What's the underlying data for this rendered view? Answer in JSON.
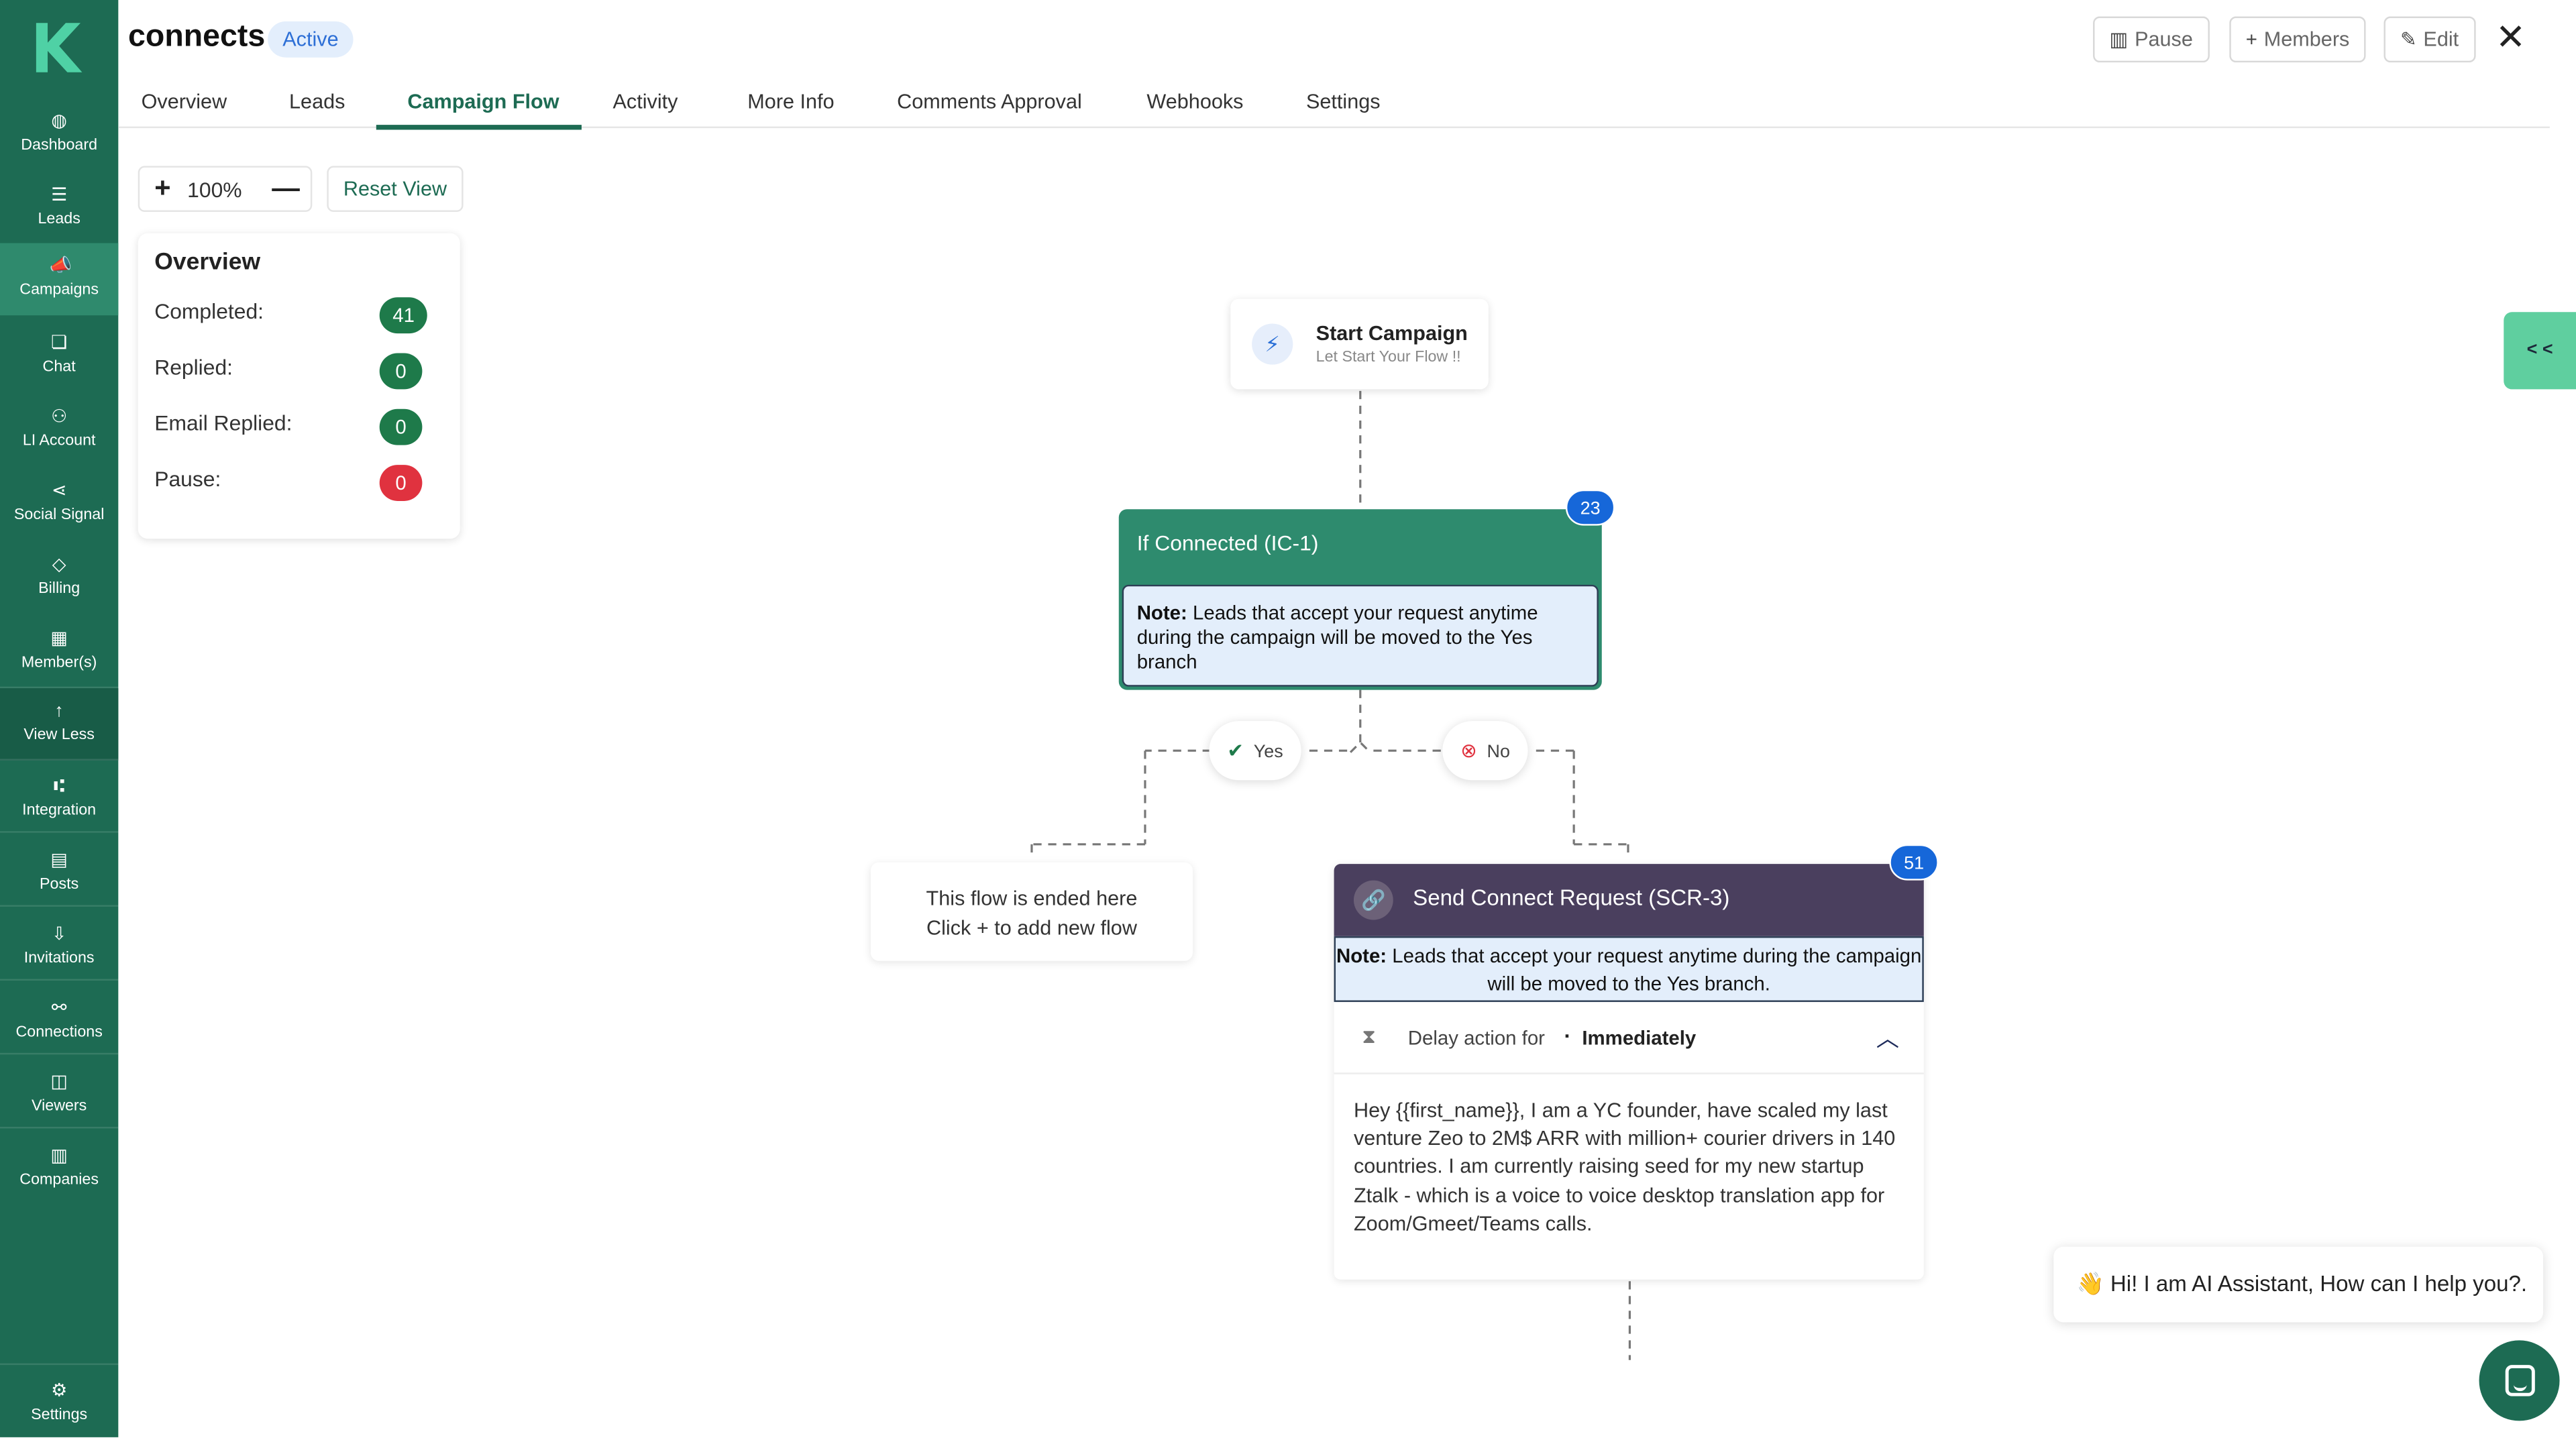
{
  "sidebar": {
    "items": [
      {
        "label": "Dashboard",
        "icon": "dashboard-icon"
      },
      {
        "label": "Leads",
        "icon": "list-icon"
      },
      {
        "label": "Campaigns",
        "icon": "megaphone-icon"
      },
      {
        "label": "Chat",
        "icon": "chat-icon"
      },
      {
        "label": "LI Account",
        "icon": "account-icon"
      },
      {
        "label": "Social Signal",
        "icon": "share-icon"
      },
      {
        "label": "Billing",
        "icon": "tag-icon"
      },
      {
        "label": "Member(s)",
        "icon": "members-icon"
      },
      {
        "label": "View Less",
        "icon": "arrow-up-icon"
      },
      {
        "label": "Integration",
        "icon": "integration-icon"
      },
      {
        "label": "Posts",
        "icon": "posts-icon"
      },
      {
        "label": "Invitations",
        "icon": "invitations-icon"
      },
      {
        "label": "Connections",
        "icon": "connections-icon"
      },
      {
        "label": "Viewers",
        "icon": "viewers-icon"
      },
      {
        "label": "Companies",
        "icon": "companies-icon"
      }
    ],
    "settings_label": "Settings",
    "active_color": "#2f8a6d",
    "bg_color": "#1d6b53"
  },
  "header": {
    "title": "connects",
    "status_badge": "Active",
    "pause_label": "Pause",
    "members_label": "Members",
    "edit_label": "Edit"
  },
  "tabs": [
    {
      "label": "Overview"
    },
    {
      "label": "Leads"
    },
    {
      "label": "Campaign Flow",
      "active": true
    },
    {
      "label": "Activity"
    },
    {
      "label": "More Info"
    },
    {
      "label": "Comments Approval"
    },
    {
      "label": "Webhooks"
    },
    {
      "label": "Settings"
    }
  ],
  "zoom": {
    "plus": "+",
    "value": "100%",
    "minus": "—",
    "reset_label": "Reset View"
  },
  "overview": {
    "title": "Overview",
    "stats": [
      {
        "label": "Completed:",
        "value": "41",
        "color": "#1e7a4a"
      },
      {
        "label": "Replied:",
        "value": "0",
        "color": "#1e7a4a"
      },
      {
        "label": "Email Replied:",
        "value": "0",
        "color": "#1e7a4a"
      },
      {
        "label": "Pause:",
        "value": "0",
        "color": "#e0323f"
      }
    ]
  },
  "flow": {
    "start": {
      "title": "Start Campaign",
      "subtitle": "Let Start Your Flow !!"
    },
    "if_connected": {
      "title": "If Connected (IC-1)",
      "count": "23",
      "note_bold": "Note:",
      "note_text": "Leads that accept your request anytime during the campaign will be moved to the Yes branch"
    },
    "yes_label": "Yes",
    "no_label": "No",
    "ended": {
      "line1": "This flow is ended here",
      "line2": "Click + to add new flow"
    },
    "send_connect": {
      "title": "Send Connect Request (SCR-3)",
      "count": "51",
      "note_bold": "Note:",
      "note_text": "Leads that accept your request anytime during the campaign will be moved to the Yes branch.",
      "delay_label": "Delay action for",
      "delay_value": "Immediately",
      "message": "Hey {{first_name}}, I am a YC founder, have scaled my last venture Zeo to 2M$ ARR with million+ courier drivers in 140 countries. I am currently raising seed for my new startup Ztalk - which is a voice to voice desktop translation app for Zoom/Gmeet/Teams calls."
    }
  },
  "collapse_label": "< <",
  "ai_assistant": {
    "emoji": "👋",
    "text": "Hi! I am AI Assistant, How can I help you?."
  }
}
